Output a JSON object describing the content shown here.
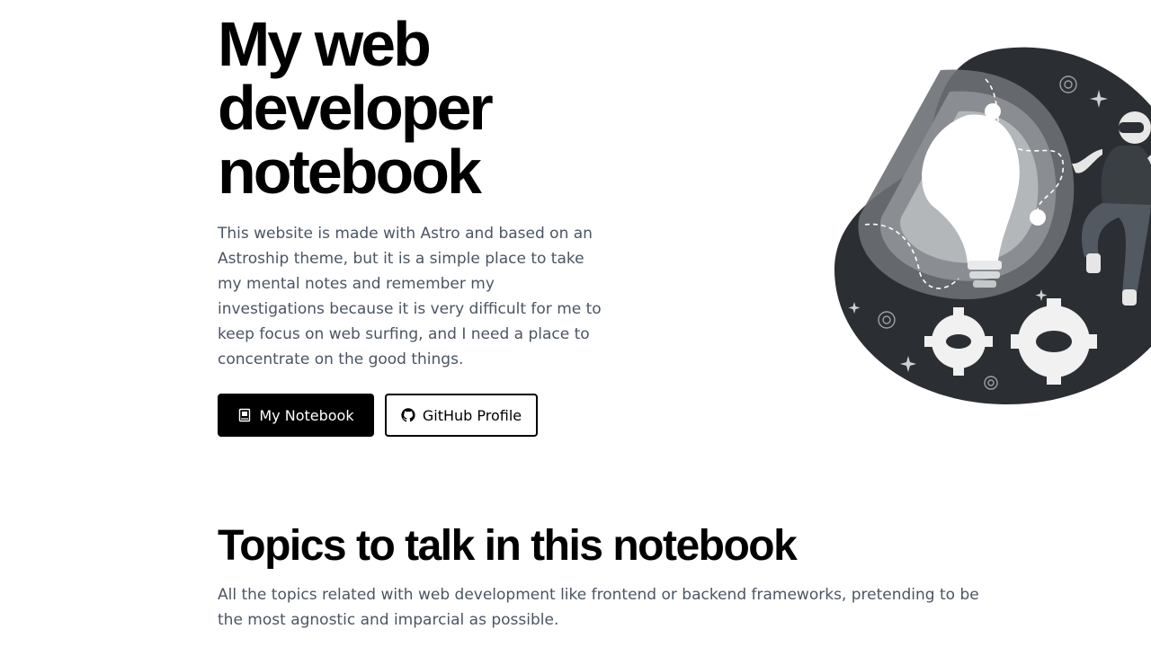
{
  "hero": {
    "title": "My web developer notebook",
    "description": "This website is made with Astro and based on an Astroship theme, but it is a simple place to take my mental notes and remember my investigations because it is very difficult for me to keep focus on web surfing, and I need a place to concentrate on the good things.",
    "primary_button": {
      "label": "My Notebook",
      "icon": "notebook-icon"
    },
    "secondary_button": {
      "label": "GitHub Profile",
      "icon": "github-icon"
    },
    "illustration": "lightbulb-astronaut-gears-illustration"
  },
  "topics": {
    "title": "Topics to talk in this notebook",
    "description": "All the topics related with web development like frontend or backend frameworks, pretending to be the most agnostic and imparcial as possible."
  },
  "colors": {
    "text": "#000000",
    "muted_text": "#4b5563",
    "blob": "#2b2f33",
    "background": "#ffffff"
  }
}
